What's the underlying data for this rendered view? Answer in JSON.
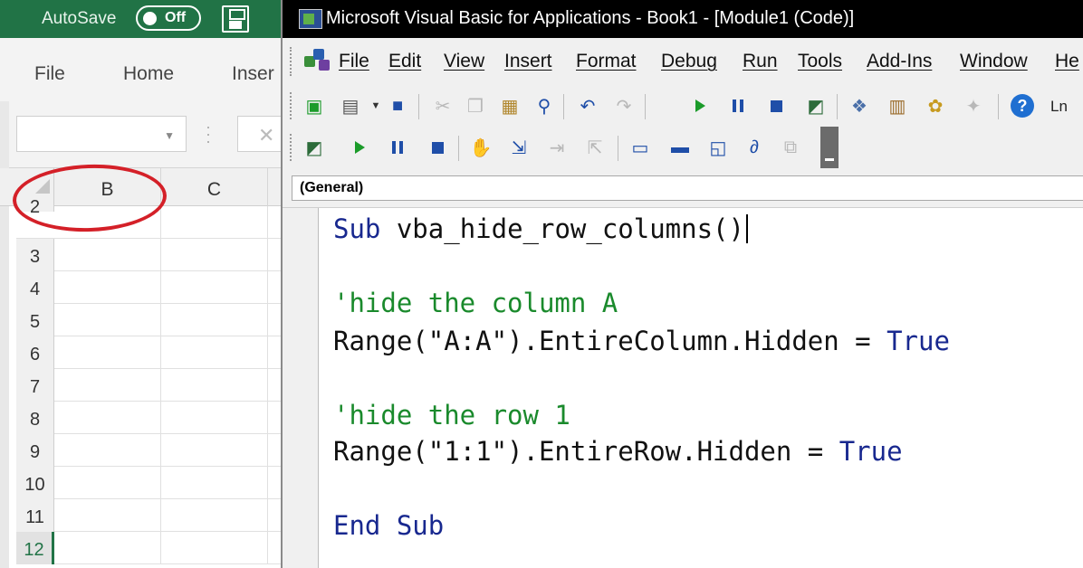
{
  "excel": {
    "autosave_label": "AutoSave",
    "autosave_state": "Off",
    "ribbon_tabs": [
      "File",
      "Home",
      "Inser"
    ],
    "column_headers": [
      "B",
      "C"
    ],
    "row_numbers": [
      "2",
      "3",
      "4",
      "5",
      "6",
      "7",
      "8",
      "9",
      "10",
      "11",
      "12"
    ],
    "active_row": "12",
    "colors": {
      "brand_green": "#217346",
      "highlight_circle": "#d42028"
    }
  },
  "vbe": {
    "title": "Microsoft Visual Basic for Applications - Book1 - [Module1 (Code)]",
    "menu": [
      "File",
      "Edit",
      "View",
      "Insert",
      "Format",
      "Debug",
      "Run",
      "Tools",
      "Add-Ins",
      "Window",
      "He"
    ],
    "toolbar_standard_icons": [
      "view-excel-icon",
      "insert-userform-icon",
      "dropdown-arrow-icon",
      "save-icon",
      "cut-icon",
      "copy-icon",
      "paste-icon",
      "find-icon",
      "undo-icon",
      "redo-icon",
      "run-icon",
      "break-icon",
      "reset-icon",
      "design-mode-icon",
      "project-explorer-icon",
      "properties-icon",
      "object-browser-icon",
      "toolbox-icon",
      "help-icon"
    ],
    "toolbar_position_label": "Ln",
    "toolbar_edit_icons": [
      "design-mode-icon",
      "run-icon",
      "break-icon",
      "reset-icon",
      "toggle-breakpoint-icon",
      "step-into-icon",
      "step-over-icon",
      "step-out-icon",
      "locals-window-icon",
      "immediate-window-icon",
      "watch-window-icon",
      "quick-watch-icon",
      "call-stack-icon"
    ],
    "object_combo": "(General)",
    "code": {
      "sub_keyword": "Sub",
      "sub_name": " vba_hide_row_columns()",
      "comment1": "'hide the column A",
      "line1": "Range(\"A:A\").EntireColumn.Hidden = ",
      "line1_value": "True",
      "comment2": "'hide the row 1",
      "line2": "Range(\"1:1\").EntireRow.Hidden = ",
      "line2_value": "True",
      "end_sub": "End Sub"
    },
    "colors": {
      "keyword": "#18288f",
      "comment": "#1a8a2c",
      "titlebar": "#000000"
    }
  }
}
